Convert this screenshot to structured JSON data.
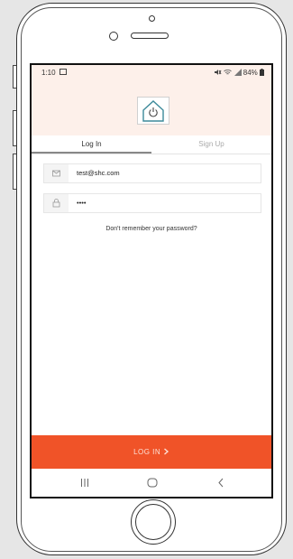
{
  "status_bar": {
    "time": "1:10",
    "battery": "84%"
  },
  "tabs": [
    {
      "label": "Log In"
    },
    {
      "label": "Sign Up"
    }
  ],
  "form": {
    "email_value": "test@shc.com",
    "password_value": "••••",
    "forgot_label": "Don't remember your password?"
  },
  "login_button": {
    "label": "LOG IN"
  },
  "colors": {
    "accent": "#f05328",
    "header_bg": "#fdf0ea"
  },
  "icons": [
    "image-icon",
    "mute-icon",
    "wifi-icon",
    "signal-icon",
    "battery-icon",
    "power-house-logo-icon",
    "mail-icon",
    "lock-icon",
    "chevron-right-icon",
    "recent-apps-icon",
    "home-icon",
    "back-icon"
  ]
}
